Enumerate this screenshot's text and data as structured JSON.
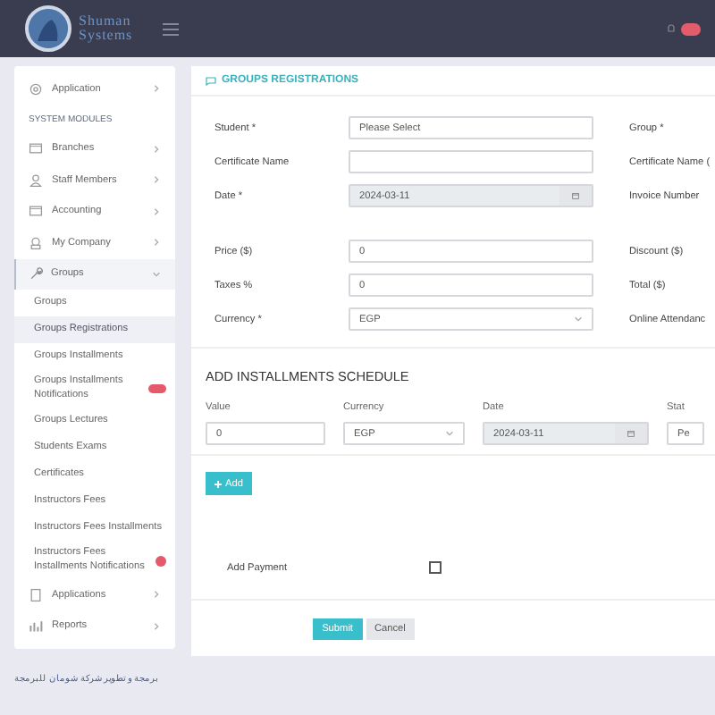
{
  "header": {
    "logo_line_1": "Shuman",
    "logo_line_2": "Systems"
  },
  "sidebar": {
    "items": [
      {
        "kind": "item",
        "label": "Application",
        "expanded": false
      },
      {
        "kind": "heading",
        "label": "SYSTEM MODULES"
      },
      {
        "kind": "item",
        "label": "Branches",
        "expanded": false
      },
      {
        "kind": "item",
        "label": "Staff Members",
        "expanded": false
      },
      {
        "kind": "item",
        "label": "Accounting",
        "expanded": false
      },
      {
        "kind": "item",
        "label": "My Company",
        "expanded": false
      },
      {
        "kind": "item",
        "label": "Groups",
        "expanded": true,
        "children": [
          {
            "label": "Groups",
            "selected": false,
            "badge": false
          },
          {
            "label": "Groups Registrations",
            "selected": true,
            "badge": false
          },
          {
            "label": "Groups Installments",
            "selected": false,
            "badge": false
          },
          {
            "label": "Groups Installments Notifications",
            "selected": false,
            "badge": true
          },
          {
            "label": "Groups Lectures",
            "selected": false,
            "badge": false
          },
          {
            "label": "Students Exams",
            "selected": false,
            "badge": false
          },
          {
            "label": "Certificates",
            "selected": false,
            "badge": false
          },
          {
            "label": "Instructors Fees",
            "selected": false,
            "badge": false
          },
          {
            "label": "Instructors Fees Installments",
            "selected": false,
            "badge": false
          },
          {
            "label": "Instructors Fees Installments Notifications",
            "selected": false,
            "badge": true
          }
        ]
      },
      {
        "kind": "item",
        "label": "Applications",
        "expanded": false
      },
      {
        "kind": "item",
        "label": "Reports",
        "expanded": false
      }
    ]
  },
  "form": {
    "title": "GROUPS REGISTRATIONS",
    "groups": [
      [
        {
          "label": "Student *",
          "kind": "select",
          "value": "Please Select",
          "right_label": "Group *"
        },
        {
          "label": "Certificate Name",
          "kind": "text",
          "right_label": "Certificate Name ("
        },
        {
          "label": "Date *",
          "kind": "date",
          "value": "2024-03-11",
          "right_label": "Invoice Number"
        }
      ],
      [
        {
          "label": "Price ($)",
          "kind": "text",
          "value": "0",
          "right_label": "Discount ($)"
        },
        {
          "label": "Taxes %",
          "kind": "text",
          "value": "0",
          "right_label": "Total ($)"
        },
        {
          "label": "Currency *",
          "kind": "dropdown",
          "value": "EGP",
          "right_label": "Online Attendanc"
        }
      ]
    ]
  },
  "schedule": {
    "title": "ADD INSTALLMENTS SCHEDULE",
    "columns": [
      {
        "label": "Value",
        "kind": "text",
        "value": "0"
      },
      {
        "label": "Currency",
        "kind": "dropdown",
        "value": "EGP"
      },
      {
        "label": "Date",
        "kind": "date",
        "value": "2024-03-11"
      },
      {
        "label": "Stat",
        "kind": "text",
        "value": "Pe"
      }
    ],
    "add_button": "Add"
  },
  "add_payment": {
    "label": "Add Payment",
    "checked": false
  },
  "buttons": [
    {
      "label": "Submit",
      "kind": "primary"
    },
    {
      "label": "Cancel",
      "kind": "secondary"
    }
  ],
  "footer": "برمجة و تطوير شركة شومان للبرمجة"
}
